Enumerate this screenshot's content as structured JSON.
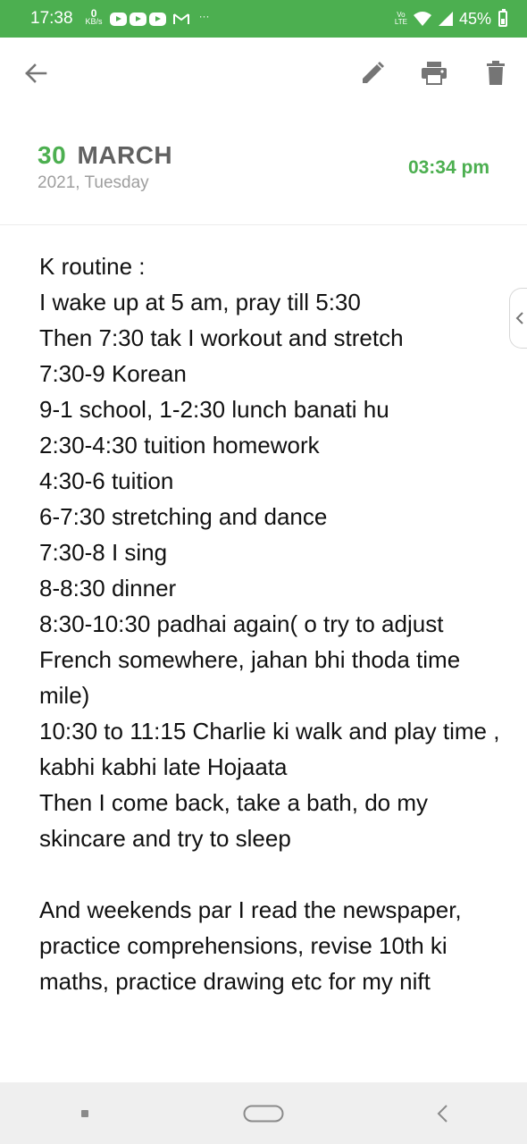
{
  "status_bar": {
    "time": "17:38",
    "net_speed_value": "0",
    "net_speed_unit": "KB/s",
    "dots": "···",
    "volte_top": "Vo",
    "volte_bottom": "LTE",
    "battery": "45%"
  },
  "toolbar": {
    "back_icon": "arrow-left-icon",
    "edit_icon": "pencil-icon",
    "print_icon": "printer-icon",
    "delete_icon": "trash-icon"
  },
  "entry": {
    "day": "30",
    "month": "MARCH",
    "year_weekday": "2021, Tuesday",
    "time": "03:34 pm"
  },
  "note_lines": [
    "K routine :",
    "I wake up at 5 am, pray till 5:30",
    "Then 7:30 tak I workout and stretch",
    "7:30-9 Korean",
    "9-1 school, 1-2:30 lunch banati hu",
    "2:30-4:30 tuition homework",
    "4:30-6 tuition",
    "6-7:30 stretching and dance",
    "7:30-8 I sing",
    "8-8:30 dinner",
    "8:30-10:30 padhai again( o try to adjust French somewhere, jahan bhi thoda time mile)",
    "10:30 to 11:15 Charlie ki walk and play time , kabhi kabhi late Hojaata",
    "Then I come back, take a bath, do my skincare and try to sleep",
    "",
    "And weekends par I read the newspaper, practice comprehensions, revise 10th ki maths, practice drawing etc for my nift"
  ],
  "colors": {
    "accent": "#4caf50",
    "month_text": "#616161",
    "sub_text": "#9e9e9e",
    "icon": "#757575"
  }
}
